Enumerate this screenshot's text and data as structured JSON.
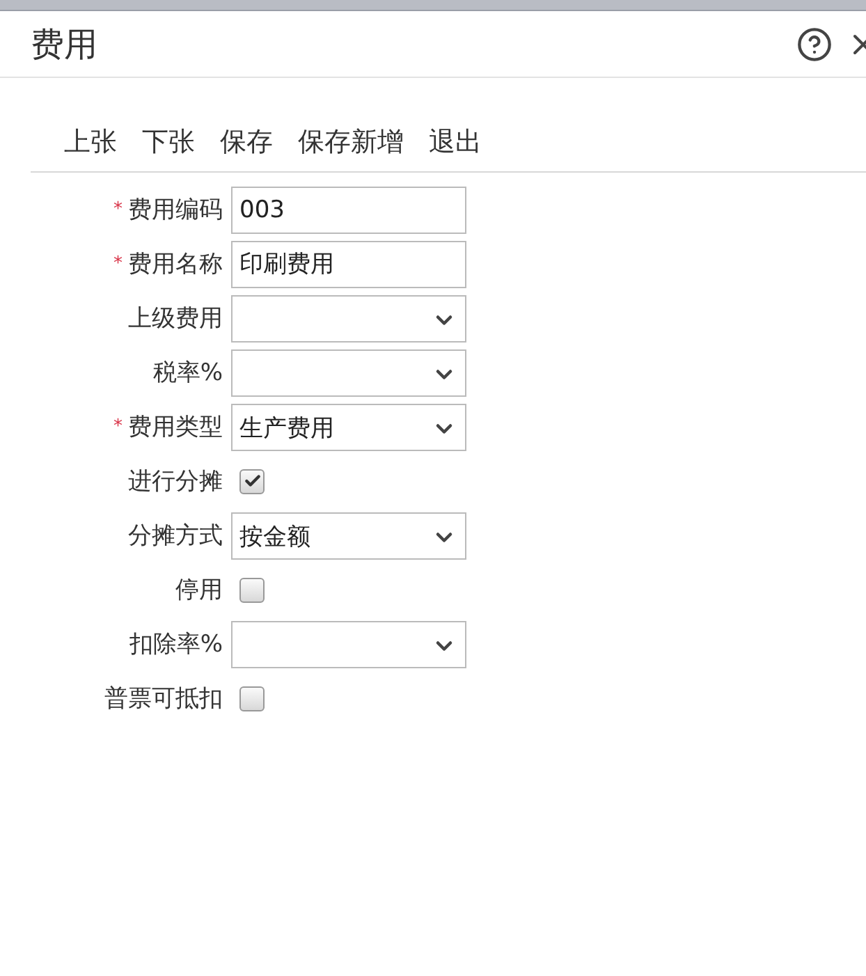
{
  "dialog": {
    "title": "费用"
  },
  "toolbar": [
    "上张",
    "下张",
    "保存",
    "保存新增",
    "退出"
  ],
  "fields": [
    {
      "label": "费用编码",
      "kind": "text",
      "required_mark": "*",
      "value": "003"
    },
    {
      "label": "费用名称",
      "kind": "text",
      "required_mark": "*",
      "value": "印刷费用"
    },
    {
      "label": "上级费用",
      "kind": "select"
    },
    {
      "label": "税率%",
      "kind": "select"
    },
    {
      "label": "费用类型",
      "kind": "select",
      "required_mark": "*",
      "value": "生产费用"
    },
    {
      "label": "进行分摊",
      "kind": "checkbox",
      "checked": true
    },
    {
      "label": "分摊方式",
      "kind": "select",
      "value": "按金额"
    },
    {
      "label": "停用",
      "kind": "checkbox",
      "checked": false
    },
    {
      "label": "扣除率%",
      "kind": "select"
    },
    {
      "label": "普票可抵扣",
      "kind": "checkbox",
      "checked": false
    }
  ]
}
